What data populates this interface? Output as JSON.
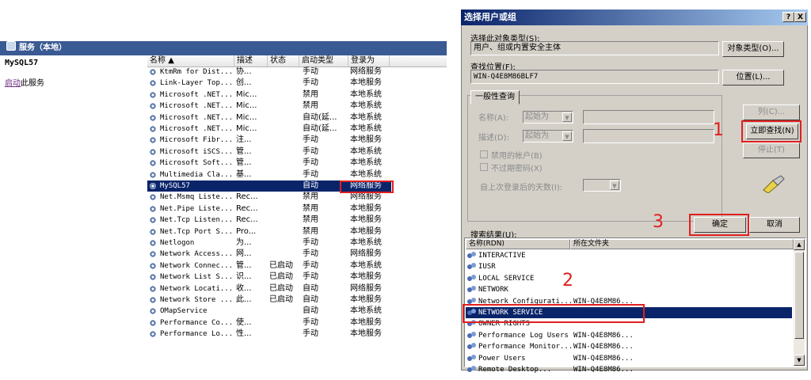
{
  "services": {
    "title": "服务（本地）",
    "selected_name": "MySQL57",
    "start_link_prefix": "启动",
    "start_link_suffix": "此服务",
    "columns": [
      "名称",
      "描述",
      "状态",
      "启动类型",
      "登录为"
    ],
    "rows": [
      [
        "KtmRm for Dist...",
        "协...",
        "",
        "手动",
        "网络服务"
      ],
      [
        "Link-Layer Top...",
        "创...",
        "",
        "手动",
        "本地服务"
      ],
      [
        "Microsoft .NET...",
        "Mic...",
        "",
        "禁用",
        "本地系统"
      ],
      [
        "Microsoft .NET...",
        "Mic...",
        "",
        "禁用",
        "本地系统"
      ],
      [
        "Microsoft .NET...",
        "Mic...",
        "",
        "自动(延...",
        "本地系统"
      ],
      [
        "Microsoft .NET...",
        "Mic...",
        "",
        "自动(延...",
        "本地系统"
      ],
      [
        "Microsoft Fibr...",
        "注...",
        "",
        "手动",
        "本地服务"
      ],
      [
        "Microsoft iSCS...",
        "管...",
        "",
        "手动",
        "本地系统"
      ],
      [
        "Microsoft Soft...",
        "管...",
        "",
        "手动",
        "本地系统"
      ],
      [
        "Multimedia Cla...",
        "基...",
        "",
        "手动",
        "本地系统"
      ],
      [
        "MySQL57",
        "",
        "",
        "自动",
        "网络服务"
      ],
      [
        "Net.Msmq Liste...",
        "Rec...",
        "",
        "禁用",
        "网络服务"
      ],
      [
        "Net.Pipe Liste...",
        "Rec...",
        "",
        "禁用",
        "本地服务"
      ],
      [
        "Net.Tcp Listen...",
        "Rec...",
        "",
        "禁用",
        "本地服务"
      ],
      [
        "Net.Tcp Port S...",
        "Pro...",
        "",
        "禁用",
        "本地服务"
      ],
      [
        "Netlogon",
        "为...",
        "",
        "手动",
        "本地系统"
      ],
      [
        "Network Access...",
        "网...",
        "",
        "手动",
        "网络服务"
      ],
      [
        "Network Connec...",
        "管...",
        "已启动",
        "手动",
        "本地系统"
      ],
      [
        "Network List S...",
        "识...",
        "已启动",
        "手动",
        "本地服务"
      ],
      [
        "Network Locati...",
        "收...",
        "已启动",
        "自动",
        "网络服务"
      ],
      [
        "Network Store ...",
        "此...",
        "已启动",
        "自动",
        "本地服务"
      ],
      [
        "OMapService",
        "",
        "",
        "自动",
        "本地系统"
      ],
      [
        "Performance Co...",
        "使...",
        "",
        "手动",
        "本地服务"
      ],
      [
        "Performance Lo...",
        "性...",
        "",
        "手动",
        "本地服务"
      ]
    ],
    "selected_row": 10
  },
  "dialog": {
    "title": "选择用户或组",
    "help_btn": "?",
    "close_btn": "X",
    "object_type_label": "选择此对象类型(S):",
    "object_type_value": "用户、组或内置安全主体",
    "object_type_btn": "对象类型(O)...",
    "location_label": "查找位置(F):",
    "location_value": "WIN-Q4E8M86BLF7",
    "location_btn": "位置(L)...",
    "tab_label": "一般性查询",
    "name_label": "名称(A):",
    "desc_label": "描述(D):",
    "starts_with": "起始为",
    "disabled_accounts": "禁用的帐户(B)",
    "no_expire_pwd": "不过期密码(X)",
    "days_since_logon": "自上次登录后的天数(I):",
    "columns_btn": "列(C)...",
    "find_now_btn": "立即查找(N)",
    "stop_btn": "停止(T)",
    "results_label": "搜索结果(U):",
    "ok_btn": "确定",
    "cancel_btn": "取消",
    "results_columns": [
      "名称(RDN)",
      "所在文件夹"
    ],
    "results": [
      [
        "INTERACTIVE",
        ""
      ],
      [
        "IUSR",
        ""
      ],
      [
        "LOCAL SERVICE",
        ""
      ],
      [
        "NETWORK",
        ""
      ],
      [
        "Network Configurati...",
        "WIN-Q4E8M86..."
      ],
      [
        "NETWORK SERVICE",
        ""
      ],
      [
        "OWNER RIGHTS",
        ""
      ],
      [
        "Performance Log Users",
        "WIN-Q4E8M86..."
      ],
      [
        "Performance Monitor...",
        "WIN-Q4E8M86..."
      ],
      [
        "Power Users",
        "WIN-Q4E8M86..."
      ],
      [
        "Remote Desktop...",
        "WIN-Q4E8M86..."
      ]
    ],
    "selected_result": 5
  },
  "annotations": [
    "1",
    "2",
    "3"
  ],
  "colors": {
    "highlight": "#0a246a",
    "annotation_red": "#e02020"
  }
}
